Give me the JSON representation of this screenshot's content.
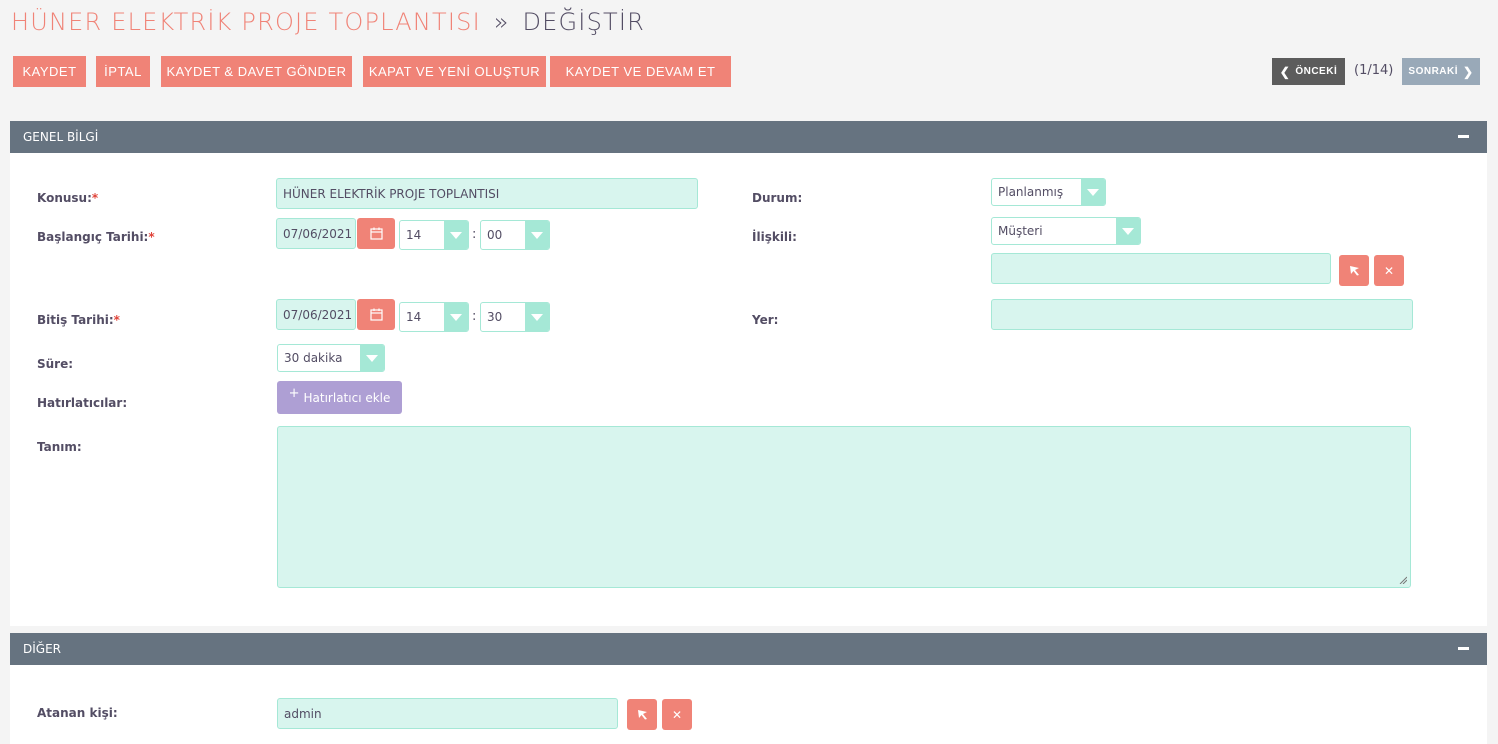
{
  "title": {
    "record": "HÜNER ELEKTRİK PROJE TOPLANTISI",
    "separator": "»",
    "action": "DEĞİŞTİR"
  },
  "actions": {
    "save": "KAYDET",
    "cancel": "İPTAL",
    "save_invite": "KAYDET & DAVET GÖNDER",
    "close_new": "KAPAT VE YENİ OLUŞTUR",
    "save_continue": "KAYDET VE DEVAM ET"
  },
  "nav": {
    "prev": "ÖNCEKİ",
    "count": "(1/14)",
    "next": "SONRAKİ"
  },
  "panels": {
    "general": "GENEL BİLGİ",
    "other": "DİĞER"
  },
  "labels": {
    "subject": "Konusu:",
    "start": "Başlangıç Tarihi:",
    "end": "Bitiş Tarihi:",
    "duration": "Süre:",
    "reminders": "Hatırlatıcılar:",
    "description": "Tanım:",
    "status": "Durum:",
    "related": "İlişkili:",
    "location": "Yer:",
    "assigned": "Atanan kişi:",
    "required_mark": "*"
  },
  "values": {
    "subject": "HÜNER ELEKTRİK PROJE TOPLANTISI",
    "start_date": "07/06/2021",
    "start_hour": "14",
    "start_minute": "00",
    "end_date": "07/06/2021",
    "end_hour": "14",
    "end_minute": "30",
    "duration": "30 dakika",
    "status": "Planlanmış",
    "related_type": "Müşteri",
    "related_name": "",
    "location": "",
    "description": "",
    "assigned": "admin",
    "time_separator": ":"
  },
  "reminder_button": "Hatırlatıcı ekle",
  "colors": {
    "accent": "#f08377",
    "field_bg": "#d8f5ee",
    "field_border": "#a5e8d6",
    "panel_header": "#667380",
    "reminder": "#ae9fd4"
  }
}
